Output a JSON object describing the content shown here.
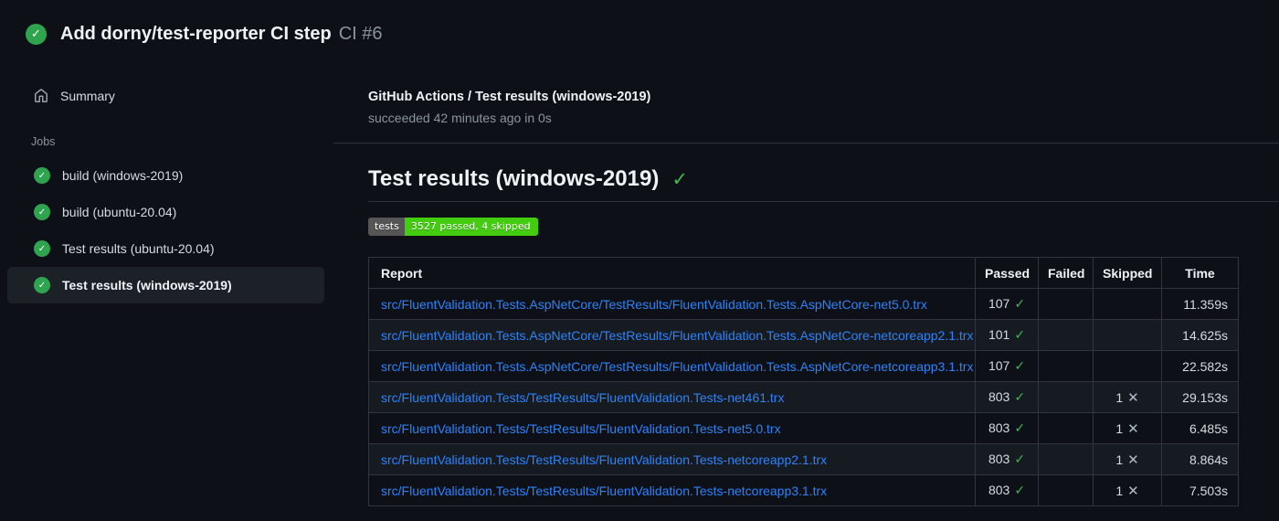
{
  "icons": {
    "check": "✓",
    "cross": "✕"
  },
  "colors": {
    "page_bg": "#0d1117",
    "success_green": "#2ea44f",
    "check_green": "#3fb950",
    "link_blue": "#2f81f7",
    "badge_label_bg": "#555555",
    "badge_value_bg": "#44cc11",
    "selected_item_bg": "#1c2128",
    "border": "#30363d",
    "muted_text": "#8b949e"
  },
  "header": {
    "title": "Add dorny/test-reporter CI step",
    "run_number": "CI #6"
  },
  "sidebar": {
    "summary_label": "Summary",
    "jobs_label": "Jobs",
    "jobs": [
      {
        "label": "build (windows-2019)",
        "status": "success",
        "selected": false
      },
      {
        "label": "build (ubuntu-20.04)",
        "status": "success",
        "selected": false
      },
      {
        "label": "Test results (ubuntu-20.04)",
        "status": "success",
        "selected": false
      },
      {
        "label": "Test results (windows-2019)",
        "status": "success",
        "selected": true
      }
    ]
  },
  "main": {
    "check_title": "GitHub Actions / Test results (windows-2019)",
    "check_status": "succeeded 42 minutes ago in 0s",
    "section_title": "Test results (windows-2019)",
    "badge": {
      "label": "tests",
      "value": "3527 passed, 4 skipped"
    },
    "table": {
      "headers": [
        "Report",
        "Passed",
        "Failed",
        "Skipped",
        "Time"
      ],
      "rows": [
        {
          "report": "src/FluentValidation.Tests.AspNetCore/TestResults/FluentValidation.Tests.AspNetCore-net5.0.trx",
          "passed": "107",
          "failed": "",
          "skipped": "",
          "time": "11.359s"
        },
        {
          "report": "src/FluentValidation.Tests.AspNetCore/TestResults/FluentValidation.Tests.AspNetCore-netcoreapp2.1.trx",
          "passed": "101",
          "failed": "",
          "skipped": "",
          "time": "14.625s"
        },
        {
          "report": "src/FluentValidation.Tests.AspNetCore/TestResults/FluentValidation.Tests.AspNetCore-netcoreapp3.1.trx",
          "passed": "107",
          "failed": "",
          "skipped": "",
          "time": "22.582s"
        },
        {
          "report": "src/FluentValidation.Tests/TestResults/FluentValidation.Tests-net461.trx",
          "passed": "803",
          "failed": "",
          "skipped": "1",
          "time": "29.153s"
        },
        {
          "report": "src/FluentValidation.Tests/TestResults/FluentValidation.Tests-net5.0.trx",
          "passed": "803",
          "failed": "",
          "skipped": "1",
          "time": "6.485s"
        },
        {
          "report": "src/FluentValidation.Tests/TestResults/FluentValidation.Tests-netcoreapp2.1.trx",
          "passed": "803",
          "failed": "",
          "skipped": "1",
          "time": "8.864s"
        },
        {
          "report": "src/FluentValidation.Tests/TestResults/FluentValidation.Tests-netcoreapp3.1.trx",
          "passed": "803",
          "failed": "",
          "skipped": "1",
          "time": "7.503s"
        }
      ]
    }
  }
}
